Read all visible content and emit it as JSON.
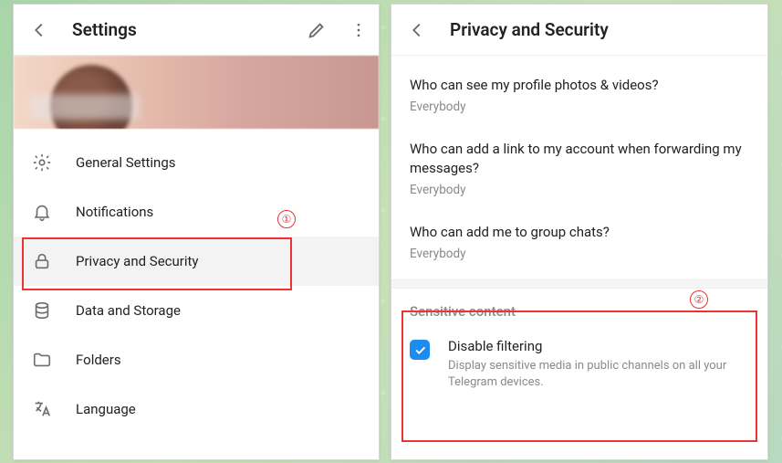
{
  "leftPanel": {
    "title": "Settings",
    "menu": [
      {
        "label": "General Settings",
        "selected": false
      },
      {
        "label": "Notifications",
        "selected": false
      },
      {
        "label": "Privacy and Security",
        "selected": true
      },
      {
        "label": "Data and Storage",
        "selected": false
      },
      {
        "label": "Folders",
        "selected": false
      },
      {
        "label": "Language",
        "selected": false
      }
    ]
  },
  "rightPanel": {
    "title": "Privacy and Security",
    "items": [
      {
        "title": "Who can see my profile photos & videos?",
        "value": "Everybody"
      },
      {
        "title": "Who can add a link to my account when forwarding my messages?",
        "value": "Everybody"
      },
      {
        "title": "Who can add me to group chats?",
        "value": "Everybody"
      }
    ],
    "sensitiveSection": {
      "header": "Sensitive content",
      "checkbox": {
        "checked": true,
        "title": "Disable filtering",
        "description": "Display sensitive media in public channels on all your Telegram devices."
      }
    }
  },
  "annotations": {
    "badge1": "①",
    "badge2": "②"
  }
}
